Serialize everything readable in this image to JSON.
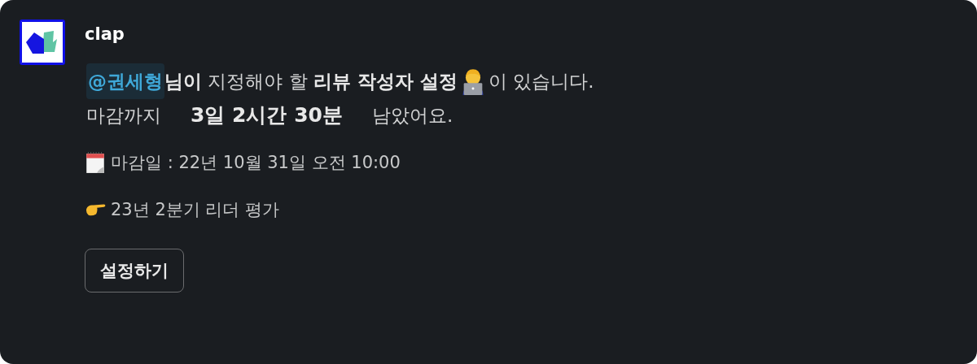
{
  "bot": {
    "name": "clap"
  },
  "message": {
    "mention": "@권세형",
    "text_before_icon": "**님이** 지정해야 할 **리뷰 작성자 설정**",
    "text_after_icon": "이 있습니다.",
    "deadline_prefix": "마감까지",
    "remaining": "3일 2시간 30분",
    "deadline_suffix": "남았어요."
  },
  "details": [
    {
      "kind": "calendar",
      "text": "마감일 : 22년 10월 31일 오전 10:00"
    },
    {
      "kind": "pointer",
      "text": "23년 2분기 리더 평가"
    }
  ],
  "buttons": [
    {
      "label": "설정하기"
    }
  ]
}
